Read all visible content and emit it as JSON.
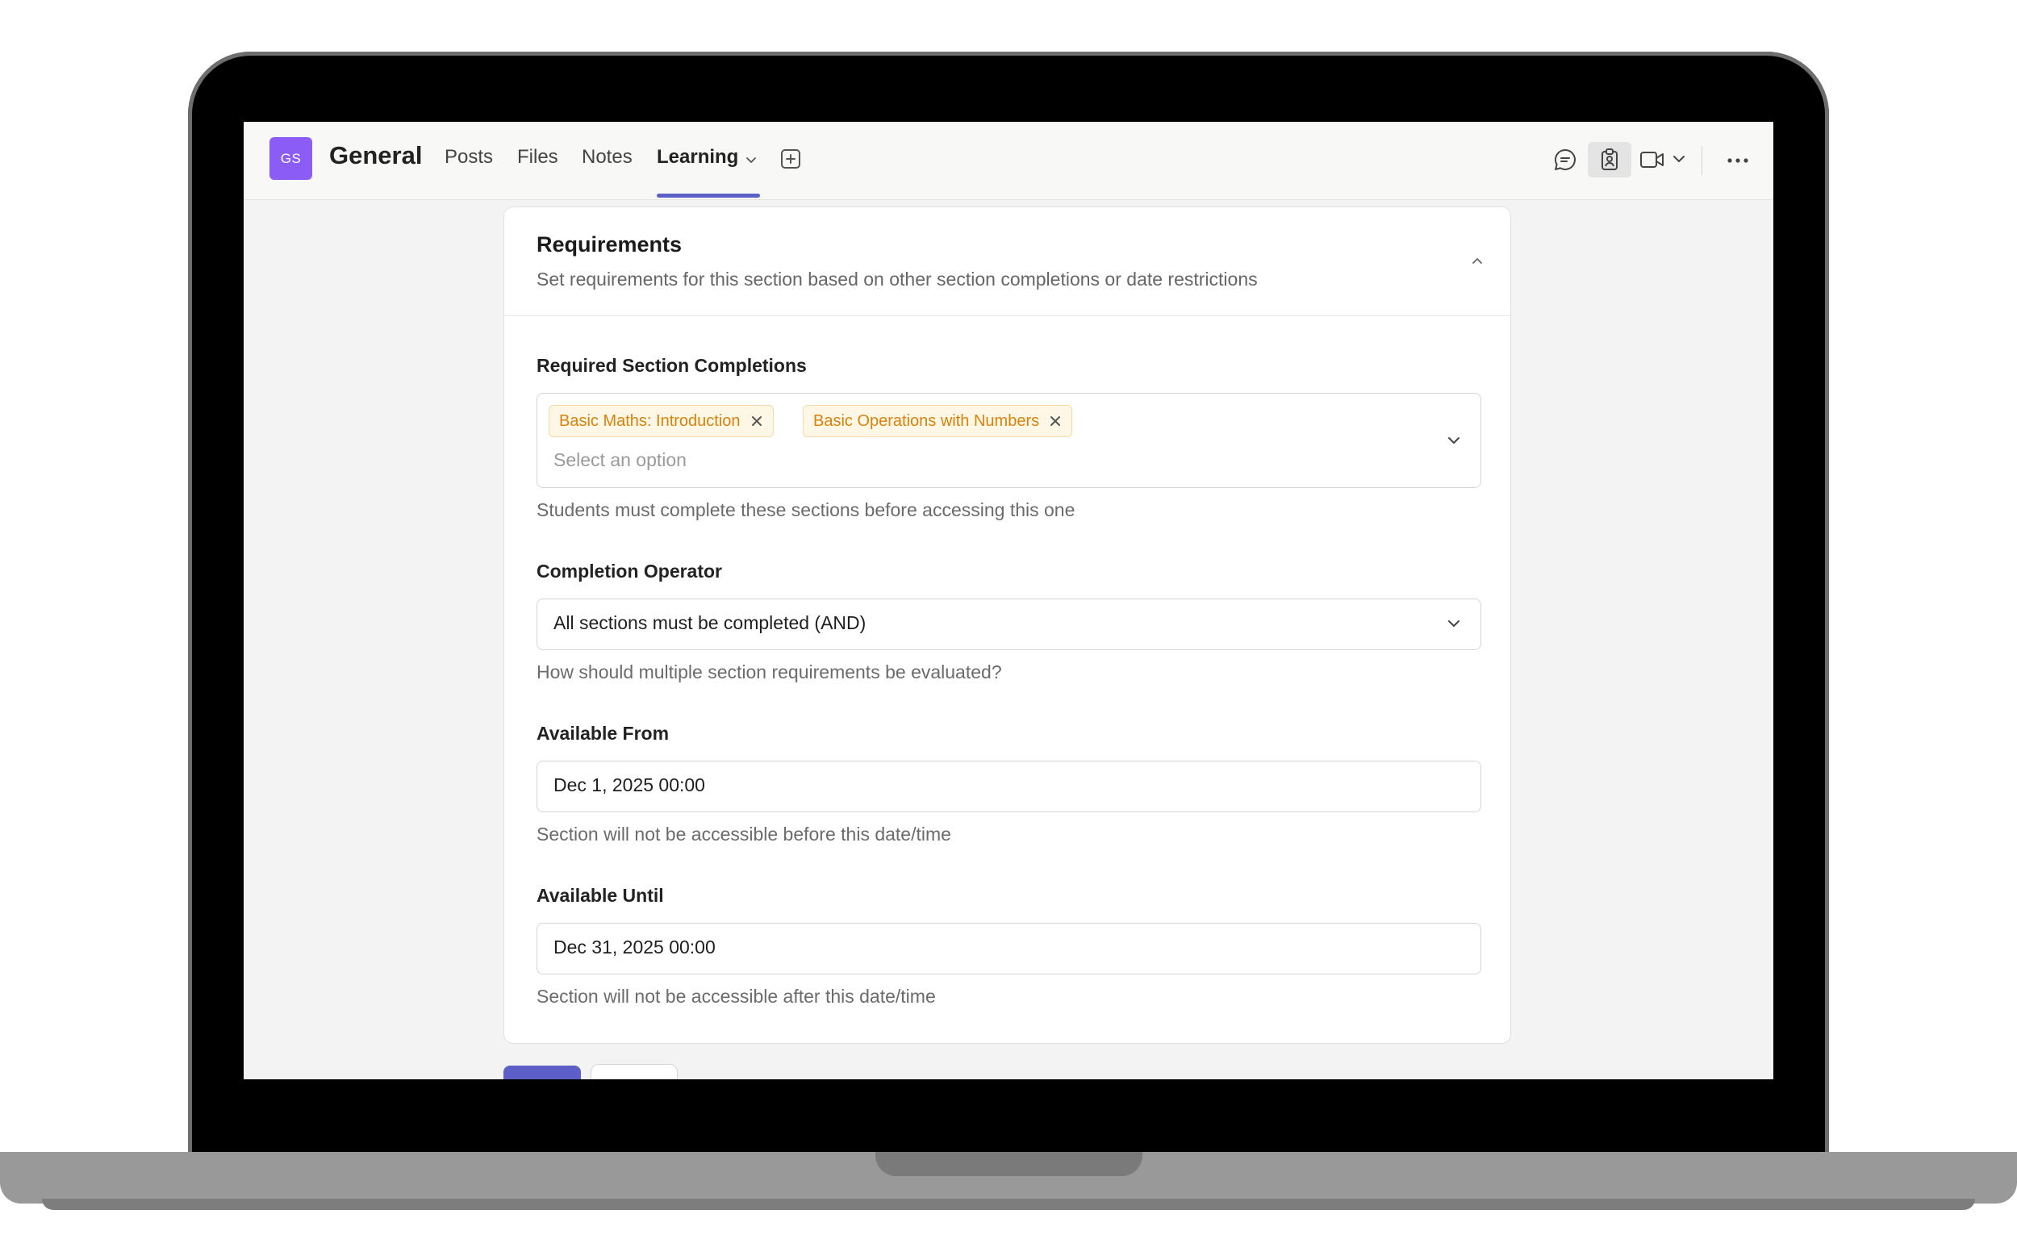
{
  "team": {
    "initials": "GS",
    "channel_name": "General",
    "accent": "#8b5cf6"
  },
  "tabs": [
    {
      "label": "Posts"
    },
    {
      "label": "Files"
    },
    {
      "label": "Notes"
    },
    {
      "label": "Learning",
      "active": true
    }
  ],
  "topbar_icons": [
    "chat-icon",
    "clipboard-icon",
    "video-icon",
    "chevron-down-icon",
    "more-icon",
    "add-tab-icon"
  ],
  "requirements": {
    "title": "Requirements",
    "subtitle": "Set requirements for this section based on other section completions or date restrictions",
    "required_sections": {
      "label": "Required Section Completions",
      "chips": [
        "Basic Maths: Introduction",
        "Basic Operations with Numbers"
      ],
      "placeholder": "Select an option",
      "helper": "Students must complete these sections before accessing this one"
    },
    "completion_operator": {
      "label": "Completion Operator",
      "value": "All sections must be completed (AND)",
      "helper": "How should multiple section requirements be evaluated?"
    },
    "available_from": {
      "label": "Available From",
      "value": "Dec 1, 2025 00:00",
      "helper": "Section will not be accessible before this date/time"
    },
    "available_until": {
      "label": "Available Until",
      "value": "Dec 31, 2025 00:00",
      "helper": "Section will not be accessible after this date/time"
    }
  },
  "colors": {
    "primary": "#5b5fc7",
    "chip_bg": "#fff7e6",
    "chip_text": "#d9820b"
  }
}
